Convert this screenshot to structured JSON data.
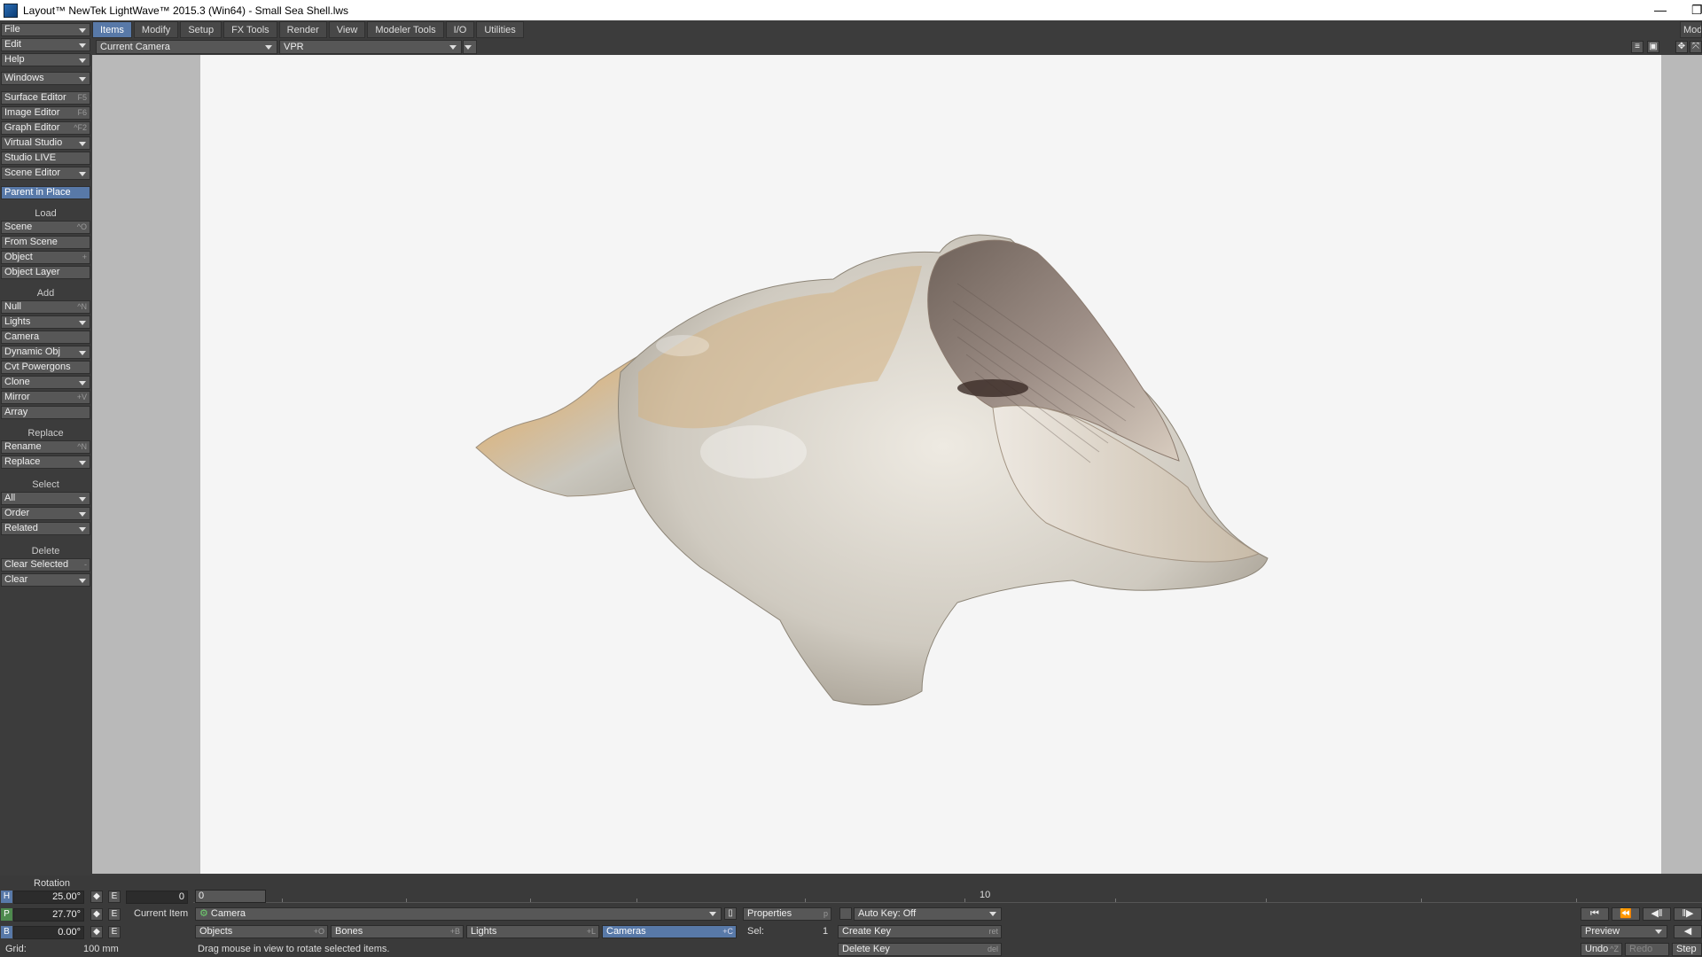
{
  "window": {
    "title": "Layout™ NewTek LightWave™ 2015.3 (Win64) - Small Sea Shell.lws",
    "minimize_glyph": "—",
    "maximize_glyph": "❐"
  },
  "tabs": [
    {
      "label": "Items",
      "active": true
    },
    {
      "label": "Modify"
    },
    {
      "label": "Setup"
    },
    {
      "label": "FX Tools"
    },
    {
      "label": "Render"
    },
    {
      "label": "View"
    },
    {
      "label": "Modeler Tools"
    },
    {
      "label": "I/O"
    },
    {
      "label": "Utilities"
    }
  ],
  "corner_tab": "Mod",
  "sidebar": {
    "file": "File",
    "edit": "Edit",
    "help": "Help",
    "windows": "Windows",
    "surface_editor": "Surface Editor",
    "surface_editor_key": "F5",
    "image_editor": "Image Editor",
    "image_editor_key": "F6",
    "graph_editor": "Graph Editor",
    "graph_editor_key": "^F2",
    "virtual_studio": "Virtual Studio",
    "studio_live": "Studio LIVE",
    "scene_editor": "Scene Editor",
    "parent_in_place": "Parent in Place",
    "load_head": "Load",
    "scene": "Scene",
    "scene_key": "^O",
    "from_scene": "From Scene",
    "object": "Object",
    "object_key": "+",
    "object_layer": "Object Layer",
    "add_head": "Add",
    "null": "Null",
    "null_key": "^N",
    "lights": "Lights",
    "camera": "Camera",
    "dynamic_obj": "Dynamic Obj",
    "cvt_powergons": "Cvt Powergons",
    "clone": "Clone",
    "mirror": "Mirror",
    "mirror_key": "+V",
    "array": "Array",
    "replace_head": "Replace",
    "rename": "Rename",
    "rename_key": "^N",
    "replace": "Replace",
    "select_head": "Select",
    "all": "All",
    "order": "Order",
    "related": "Related",
    "delete_head": "Delete",
    "clear_selected": "Clear Selected",
    "clear_selected_key": "-",
    "clear": "Clear"
  },
  "viewport_toolbar": {
    "camera_view": "Current Camera",
    "render_mode": "VPR"
  },
  "bottom": {
    "rotation_label": "Rotation",
    "h_label": "H",
    "h_value": "25.00°",
    "p_label": "P",
    "p_value": "27.70°",
    "b_label": "B",
    "b_value": "0.00°",
    "e_label": "E",
    "grid_label": "Grid:",
    "grid_value": "100 mm",
    "frame_start": "0",
    "frame_current": "0",
    "timeline_label_10": "10",
    "current_item_label": "Current Item",
    "current_item_value": "Camera",
    "properties": "Properties",
    "properties_key": "p",
    "auto_key": "Auto Key: Off",
    "objects": "Objects",
    "objects_key": "+O",
    "bones": "Bones",
    "bones_key": "+B",
    "lights": "Lights",
    "lights_key": "+L",
    "cameras": "Cameras",
    "cameras_key": "+C",
    "sel_label": "Sel:",
    "sel_value": "1",
    "create_key": "Create Key",
    "create_key_key": "ret",
    "delete_key": "Delete Key",
    "delete_key_key": "del",
    "status": "Drag mouse in view to rotate selected items.",
    "preview": "Preview",
    "undo": "Undo",
    "undo_key": "^Z",
    "redo": "Redo",
    "step": "Step"
  },
  "colors": {
    "accent": "#5879a8",
    "viewport_bg": "#f5f5f5",
    "panel": "#3c3c3c"
  }
}
